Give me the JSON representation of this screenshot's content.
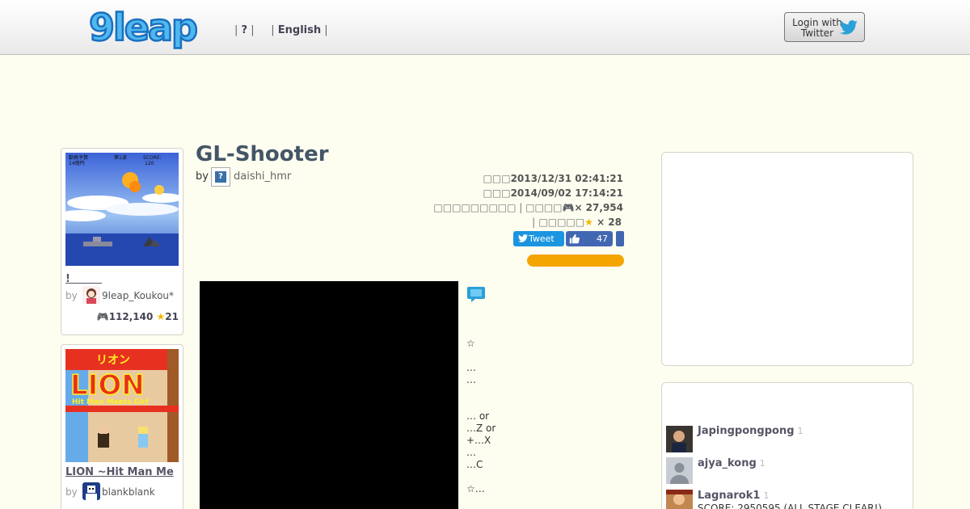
{
  "header": {
    "logo_text": "9leap",
    "nav_sep1": "| ",
    "nav_help": "?",
    "nav_sep2": " |     | ",
    "nav_lang": "English",
    "nav_sep3": " |",
    "login_line1": "Login with",
    "login_line2": "Twitter"
  },
  "left_games": [
    {
      "title": "!　　　",
      "by": "by",
      "author": "9leap_Koukou*",
      "plays": "112,140",
      "stars": "21"
    },
    {
      "title": "LION ~Hit Man Me",
      "by": "by",
      "author": "blankblank",
      "thumb_text_top": "リオン",
      "thumb_text_big": "LION",
      "thumb_text_sub": "Hit Man Meets Girl"
    }
  ],
  "game": {
    "title": "GL-Shooter",
    "by": "by",
    "author": "daishi_hmr",
    "created_label": "□□□",
    "created": "2013/12/31 02:41:21",
    "updated_label": "□□□",
    "updated": "2014/09/02 17:14:21",
    "plays_label_a": "□□□□□□□□□",
    "plays_sep": " | ",
    "plays_label_b": "□□□□",
    "plays_count": "× 27,954",
    "stars_sep": "|",
    "stars_label": "□□□□□",
    "stars_count": "× 28",
    "tweet_label": "Tweet",
    "like_count": "47"
  },
  "description": [
    "☆",
    "…",
    "…",
    "… or",
    "…Z or",
    "+…X",
    "…",
    "…C",
    "☆…"
  ],
  "players": [
    {
      "name": "Japingpongpong",
      "count": "1"
    },
    {
      "name": "ajya_kong",
      "count": "1"
    },
    {
      "name": "Lagnarok1",
      "count": "1",
      "score": "SCORE: 2950595 (ALL STAGE CLEAR!)"
    }
  ],
  "thumb1": {
    "hud_left": "勤務予算",
    "hud_left_val": "14億円",
    "hud_mid": "第1波",
    "hud_right": "SCORE:",
    "hud_right_val": "120"
  },
  "colors": {
    "accent": "#445566",
    "orange": "#f5a500",
    "twitter": "#1b95e0",
    "facebook": "#4267b2"
  }
}
